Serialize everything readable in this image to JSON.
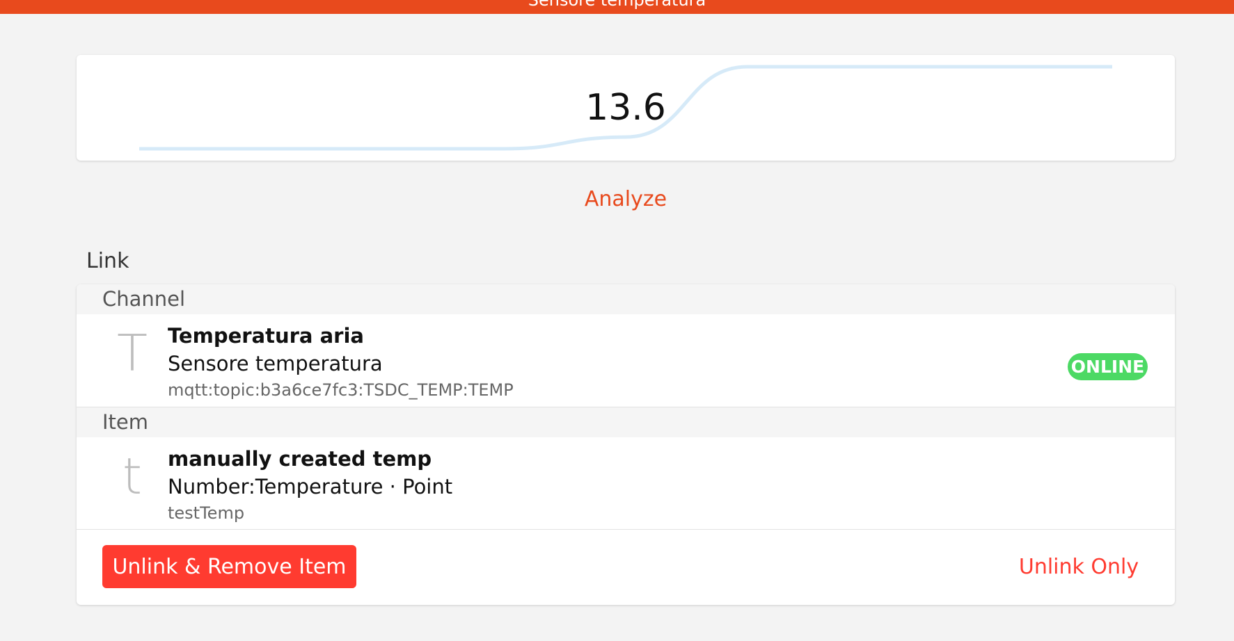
{
  "header": {
    "title": "Sensore temperatura"
  },
  "state": {
    "value": "13.6",
    "sparkline": [
      12.9,
      12.9,
      12.9,
      12.9,
      13.0,
      13.6,
      13.6,
      13.6,
      13.6
    ],
    "sparkline_color": "#d6eaf8"
  },
  "analyze_label": "Analyze",
  "link": {
    "section_label": "Link",
    "channel": {
      "group_label": "Channel",
      "icon_letter": "T",
      "title": "Temperatura aria",
      "subtitle": "Sensore temperatura",
      "uid": "mqtt:topic:b3a6ce7fc3:TSDC_TEMP:TEMP",
      "status": "ONLINE",
      "status_color": "#4cd964"
    },
    "item": {
      "group_label": "Item",
      "icon_letter": "t",
      "title": "manually created temp",
      "subtitle": "Number:Temperature · Point",
      "name": "testTemp"
    },
    "actions": {
      "unlink_remove_label": "Unlink & Remove Item",
      "unlink_only_label": "Unlink Only"
    }
  },
  "colors": {
    "accent": "#e84a1d",
    "danger": "#ff3b30"
  }
}
